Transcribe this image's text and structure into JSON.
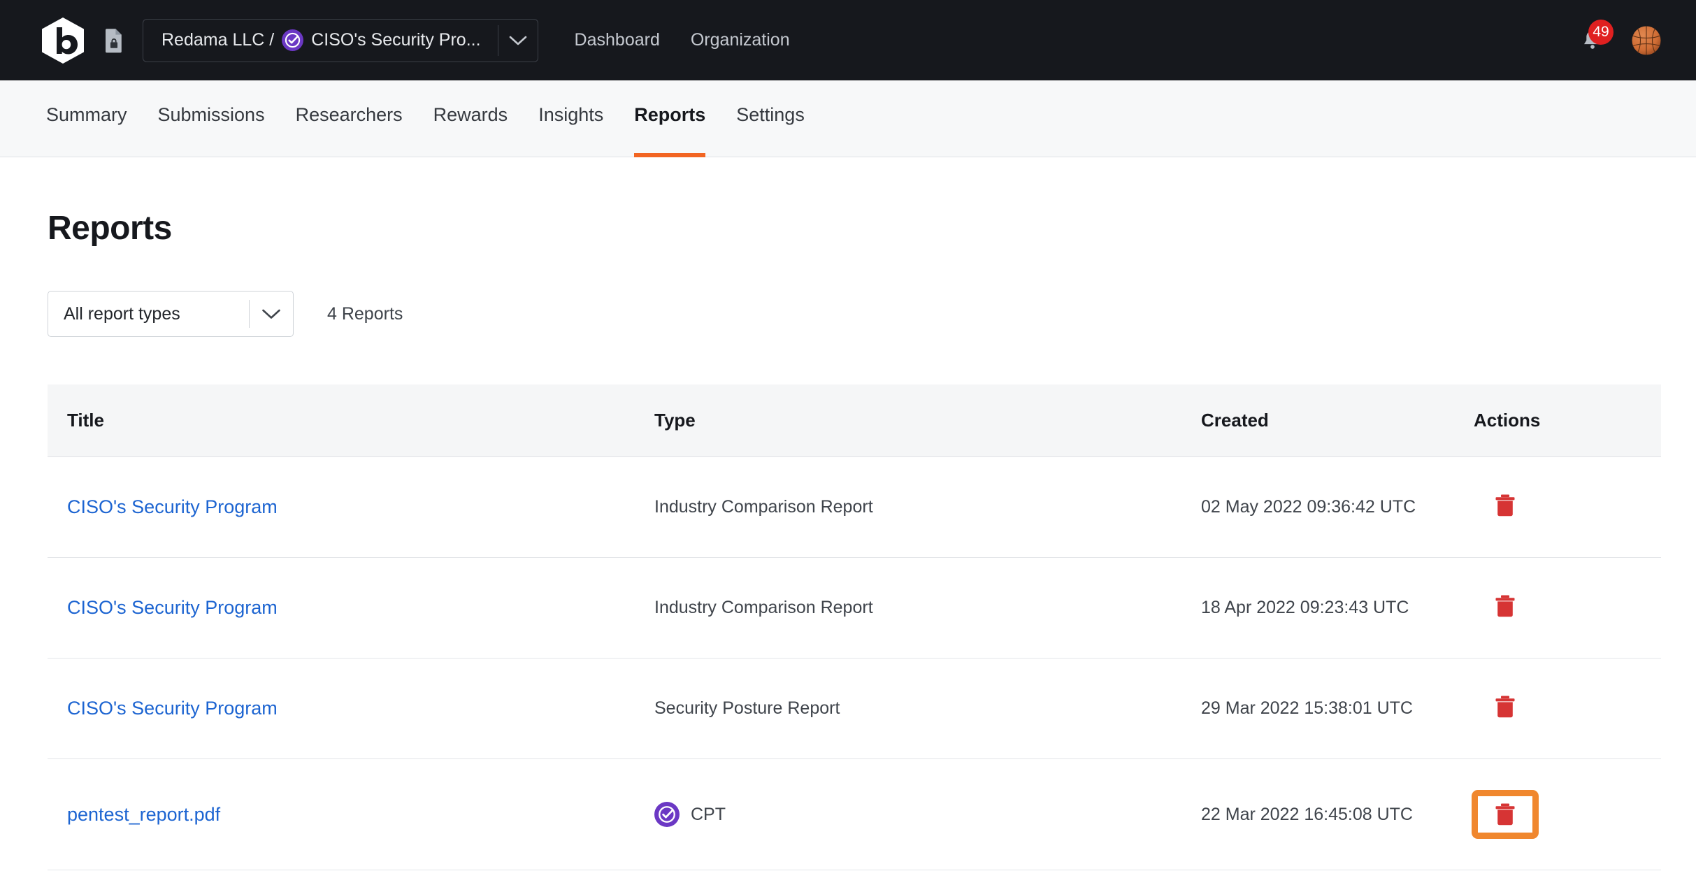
{
  "topbar": {
    "logo_name": "bugcrowd-logo",
    "doc_icon_name": "document-lock-icon",
    "org_switcher": {
      "org_prefix": "Redama LLC /",
      "program_badge_name": "ciso-program-badge-icon",
      "program_name": "CISO's Security Pro...",
      "chevron_name": "chevron-down-icon"
    },
    "nav": [
      {
        "label": "Dashboard"
      },
      {
        "label": "Organization"
      }
    ],
    "notifications": {
      "count": "49",
      "icon_name": "bell-icon"
    },
    "avatar": {
      "name": "user-avatar",
      "emoji": "basketball"
    }
  },
  "subnav": {
    "items": [
      {
        "label": "Summary",
        "active": false
      },
      {
        "label": "Submissions",
        "active": false
      },
      {
        "label": "Researchers",
        "active": false
      },
      {
        "label": "Rewards",
        "active": false
      },
      {
        "label": "Insights",
        "active": false
      },
      {
        "label": "Reports",
        "active": true
      },
      {
        "label": "Settings",
        "active": false
      }
    ],
    "active_underline_color": "#f26522"
  },
  "main": {
    "page_title": "Reports",
    "filter": {
      "selected": "All report types",
      "chevron_name": "chevron-down-icon"
    },
    "report_count": "4 Reports",
    "table": {
      "headers": [
        "Title",
        "Type",
        "Created",
        "Actions"
      ],
      "rows": [
        {
          "title": "CISO's Security Program",
          "type": "Industry Comparison Report",
          "type_badge": false,
          "created": "02 May 2022 09:36:42 UTC",
          "action_icon": "trash-icon",
          "highlighted": false
        },
        {
          "title": "CISO's Security Program",
          "type": "Industry Comparison Report",
          "type_badge": false,
          "created": "18 Apr 2022 09:23:43 UTC",
          "action_icon": "trash-icon",
          "highlighted": false
        },
        {
          "title": "CISO's Security Program",
          "type": "Security Posture Report",
          "type_badge": false,
          "created": "29 Mar 2022 15:38:01 UTC",
          "action_icon": "trash-icon",
          "highlighted": false
        },
        {
          "title": "pentest_report.pdf",
          "type": "CPT",
          "type_badge": true,
          "created": "22 Mar 2022 16:45:08 UTC",
          "action_icon": "trash-icon",
          "highlighted": true
        }
      ]
    }
  },
  "colors": {
    "topbar_bg": "#16181d",
    "accent_orange": "#f26522",
    "highlight_orange": "#f0872e",
    "link_blue": "#1c64d1",
    "badge_purple": "#6b38c4",
    "trash_red": "#d63434",
    "notification_red": "#e02020"
  }
}
